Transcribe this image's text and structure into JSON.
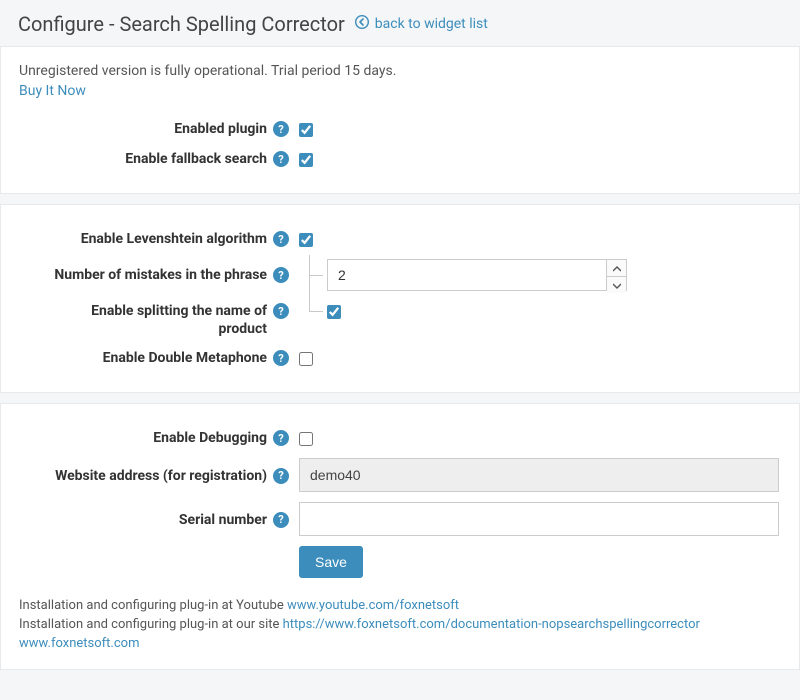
{
  "header": {
    "title": "Configure - Search Spelling Corrector",
    "back_label": "back to widget list"
  },
  "trial": {
    "message": "Unregistered version is fully operational. Trial period 15 days.",
    "buy_label": "Buy It Now"
  },
  "form": {
    "enabled_plugin": {
      "label": "Enabled plugin",
      "checked": true
    },
    "enable_fallback": {
      "label": "Enable fallback search",
      "checked": true
    },
    "enable_levenshtein": {
      "label": "Enable Levenshtein algorithm",
      "checked": true
    },
    "mistakes": {
      "label": "Number of mistakes in the phrase",
      "value": "2"
    },
    "enable_splitting": {
      "label": "Enable splitting the name of product",
      "checked": true
    },
    "enable_metaphone": {
      "label": "Enable Double Metaphone",
      "checked": false
    },
    "enable_debug": {
      "label": "Enable Debugging",
      "checked": false
    },
    "website_address": {
      "label": "Website address (for registration)",
      "value": "demo40"
    },
    "serial_number": {
      "label": "Serial number",
      "value": ""
    },
    "save_label": "Save"
  },
  "footer": {
    "yt_prefix": "Installation and configuring plug-in at Youtube ",
    "yt_link": "www.youtube.com/foxnetsoft",
    "site_prefix": "Installation and configuring plug-in at our site ",
    "site_link": "https://www.foxnetsoft.com/documentation-nopsearchspellingcorrector",
    "home_link": "www.foxnetsoft.com"
  }
}
